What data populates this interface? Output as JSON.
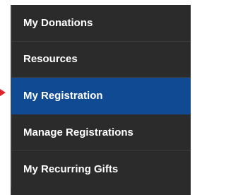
{
  "menu": {
    "items": [
      {
        "label": "My Donations",
        "active": false
      },
      {
        "label": "Resources",
        "active": false
      },
      {
        "label": "My Registration",
        "active": true
      },
      {
        "label": "Manage Registrations",
        "active": false
      },
      {
        "label": "My Recurring Gifts",
        "active": false
      }
    ]
  },
  "colors": {
    "menu_background": "#2b2b2b",
    "active_background": "#0f4a93",
    "text": "#ffffff",
    "annotation_arrow": "#e0262b"
  },
  "annotation": {
    "icon": "red-pointer-arrow-icon"
  }
}
